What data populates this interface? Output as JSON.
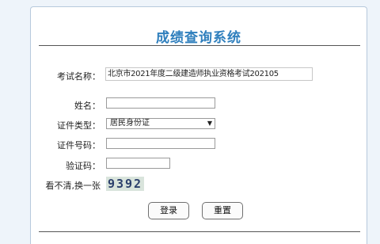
{
  "page": {
    "title": "成绩查询系统"
  },
  "form": {
    "exam_name_label": "考试名称：",
    "exam_name_value": "北京市2021年度二级建造师执业资格考试202105",
    "name_label": "姓名：",
    "name_value": "",
    "id_type_label": "证件类型：",
    "id_type_selected": "居民身份证",
    "id_number_label": "证件号码：",
    "id_number_value": "",
    "captcha_label": "验证码：",
    "captcha_value": "",
    "refresh_captcha_link": "看不清,换一张",
    "captcha_image_text": "9392"
  },
  "buttons": {
    "login": "登录",
    "reset": "重置"
  },
  "colors": {
    "title": "#2f7fbd",
    "background": "#eef4fa"
  }
}
